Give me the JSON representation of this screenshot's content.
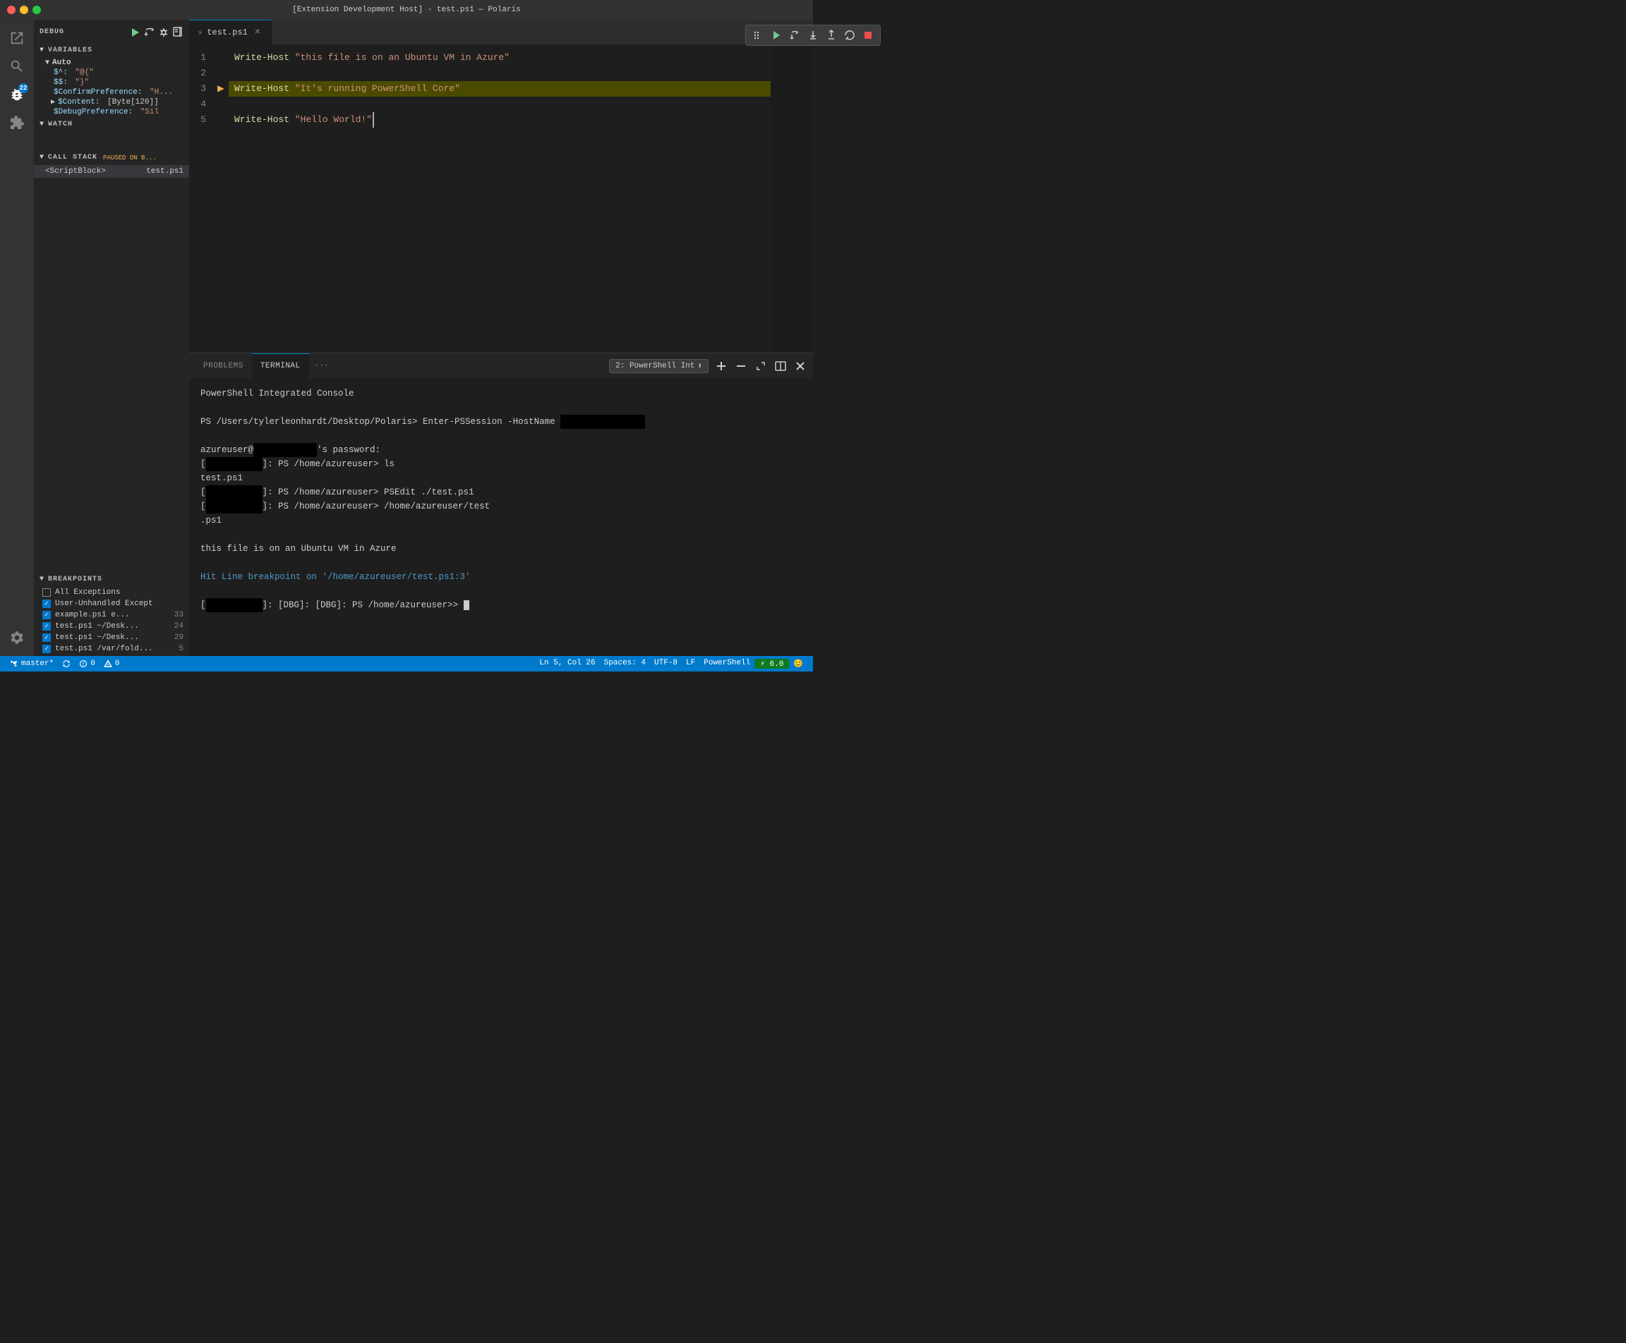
{
  "window": {
    "title": "[Extension Development Host] - test.ps1 — Polaris"
  },
  "activityBar": {
    "items": [
      {
        "id": "explorer",
        "icon": "files-icon",
        "label": "Explorer"
      },
      {
        "id": "search",
        "icon": "search-icon",
        "label": "Search"
      },
      {
        "id": "scm",
        "icon": "git-icon",
        "label": "Source Control"
      },
      {
        "id": "debug",
        "icon": "debug-icon",
        "label": "Debug",
        "badge": "22",
        "active": true
      },
      {
        "id": "extensions",
        "icon": "extensions-icon",
        "label": "Extensions"
      }
    ],
    "bottom": [
      {
        "id": "settings",
        "icon": "settings-icon",
        "label": "Settings"
      }
    ]
  },
  "sidebar": {
    "header": {
      "title": "DEBUG",
      "actions": [
        "continue",
        "step-over",
        "settings",
        "open-file"
      ]
    },
    "variables": {
      "title": "VARIABLES",
      "groups": [
        {
          "name": "Auto",
          "expanded": true,
          "items": [
            {
              "name": "$^:",
              "value": "\"@{\""
            },
            {
              "name": "$$:",
              "value": "\"}\""
            },
            {
              "name": "$ConfirmPreference:",
              "value": "\"H..."
            },
            {
              "name": "$Content:",
              "value": "[Byte[120]]",
              "expandable": true
            },
            {
              "name": "$DebugPreference:",
              "value": "\"Sil"
            }
          ]
        }
      ]
    },
    "watch": {
      "title": "WATCH"
    },
    "callStack": {
      "title": "CALL STACK",
      "badge": "PAUSED ON B...",
      "items": [
        {
          "name": "<ScriptBlock>",
          "file": "test.ps1"
        }
      ]
    },
    "breakpoints": {
      "title": "BREAKPOINTS",
      "items": [
        {
          "label": "All Exceptions",
          "checked": false
        },
        {
          "label": "User-Unhandled Except",
          "checked": true
        },
        {
          "label": "example.ps1  e...",
          "line": "33",
          "checked": true
        },
        {
          "label": "test.ps1  ~/Desk...",
          "line": "24",
          "checked": true
        },
        {
          "label": "test.ps1  ~/Desk...",
          "line": "29",
          "checked": true
        },
        {
          "label": "test.ps1  /var/fold...",
          "line": "5",
          "checked": true
        }
      ]
    }
  },
  "editor": {
    "tab": {
      "name": "test.ps1",
      "icon": "powershell-icon",
      "modified": false
    },
    "lines": [
      {
        "number": 1,
        "tokens": [
          {
            "type": "fn",
            "text": "Write-Host"
          },
          {
            "type": "punc",
            "text": " "
          },
          {
            "type": "str",
            "text": "\"this file is on an Ubuntu VM in Azure\""
          }
        ]
      },
      {
        "number": 2,
        "tokens": []
      },
      {
        "number": 3,
        "highlighted": true,
        "debugArrow": true,
        "tokens": [
          {
            "type": "fn",
            "text": "Write-Host"
          },
          {
            "type": "punc",
            "text": " "
          },
          {
            "type": "str",
            "text": "\"It's running PowerShell Core\""
          }
        ]
      },
      {
        "number": 4,
        "tokens": []
      },
      {
        "number": 5,
        "tokens": [
          {
            "type": "fn",
            "text": "Write-Host"
          },
          {
            "type": "punc",
            "text": " "
          },
          {
            "type": "str",
            "text": "\"Hello World!\""
          },
          {
            "type": "punc",
            "text": ""
          }
        ]
      }
    ]
  },
  "debugToolbar": {
    "buttons": [
      {
        "id": "drag",
        "icon": "drag-icon",
        "title": "Drag"
      },
      {
        "id": "continue",
        "icon": "play-icon",
        "title": "Continue",
        "color": "#73c991"
      },
      {
        "id": "step-over",
        "icon": "step-over-icon",
        "title": "Step Over"
      },
      {
        "id": "step-into",
        "icon": "step-into-icon",
        "title": "Step Into"
      },
      {
        "id": "step-out",
        "icon": "step-out-icon",
        "title": "Step Out"
      },
      {
        "id": "restart",
        "icon": "restart-icon",
        "title": "Restart"
      },
      {
        "id": "stop",
        "icon": "stop-icon",
        "title": "Stop",
        "color": "#f14c4c"
      }
    ]
  },
  "panel": {
    "tabs": [
      "PROBLEMS",
      "TERMINAL"
    ],
    "activeTab": "TERMINAL",
    "terminalSelector": "2: PowerShell Int",
    "terminal": {
      "lines": [
        {
          "text": "PowerShell Integrated Console",
          "type": "normal"
        },
        {
          "text": "",
          "type": "normal"
        },
        {
          "text": "PS /Users/tylerleonhardt/Desktop/Polaris> Enter-PSSession -HostName ",
          "type": "prompt",
          "redacted": true
        },
        {
          "text": "",
          "type": "normal"
        },
        {
          "text": "azureuser@",
          "type": "normal",
          "redacted2": true,
          "'s password:": true
        },
        {
          "text": "[",
          "type": "normal",
          "redacted3": true,
          "]: PS /home/azureuser> ls": true
        },
        {
          "text": "test.ps1",
          "type": "normal"
        },
        {
          "text": "[",
          "type": "normal",
          "redacted4": true,
          "]: PS /home/azureuser> PSEdit ./test.ps1": true
        },
        {
          "text": "[",
          "type": "normal",
          "redacted5": true,
          "]: PS /home/azureuser> /home/azureuser/test": true
        },
        {
          "text": ".ps1",
          "type": "normal"
        },
        {
          "text": "",
          "type": "normal"
        },
        {
          "text": "this file is on an Ubuntu VM in Azure",
          "type": "normal"
        },
        {
          "text": "",
          "type": "normal"
        },
        {
          "text": "Hit Line breakpoint on '/home/azureuser/test.ps1:3'",
          "type": "link"
        },
        {
          "text": "",
          "type": "normal"
        },
        {
          "text": "[",
          "type": "normal",
          "redacted6": true,
          "]: [DBG]: [DBG]: PS /home/azureuser>> ": true,
          "cursor": true
        }
      ]
    }
  },
  "statusBar": {
    "left": [
      {
        "id": "branch",
        "icon": "git-branch-icon",
        "text": "master*"
      },
      {
        "id": "sync",
        "icon": "sync-icon",
        "text": ""
      },
      {
        "id": "errors",
        "icon": "error-icon",
        "text": "0"
      },
      {
        "id": "warnings",
        "icon": "warning-icon",
        "text": "0"
      }
    ],
    "right": [
      {
        "id": "position",
        "text": "Ln 5, Col 26"
      },
      {
        "id": "spaces",
        "text": "Spaces: 4"
      },
      {
        "id": "encoding",
        "text": "UTF-8"
      },
      {
        "id": "eol",
        "text": "LF"
      },
      {
        "id": "language",
        "text": "PowerShell"
      },
      {
        "id": "extension",
        "text": "⚡ 6.0",
        "special": true
      }
    ],
    "smiley": "😊"
  }
}
